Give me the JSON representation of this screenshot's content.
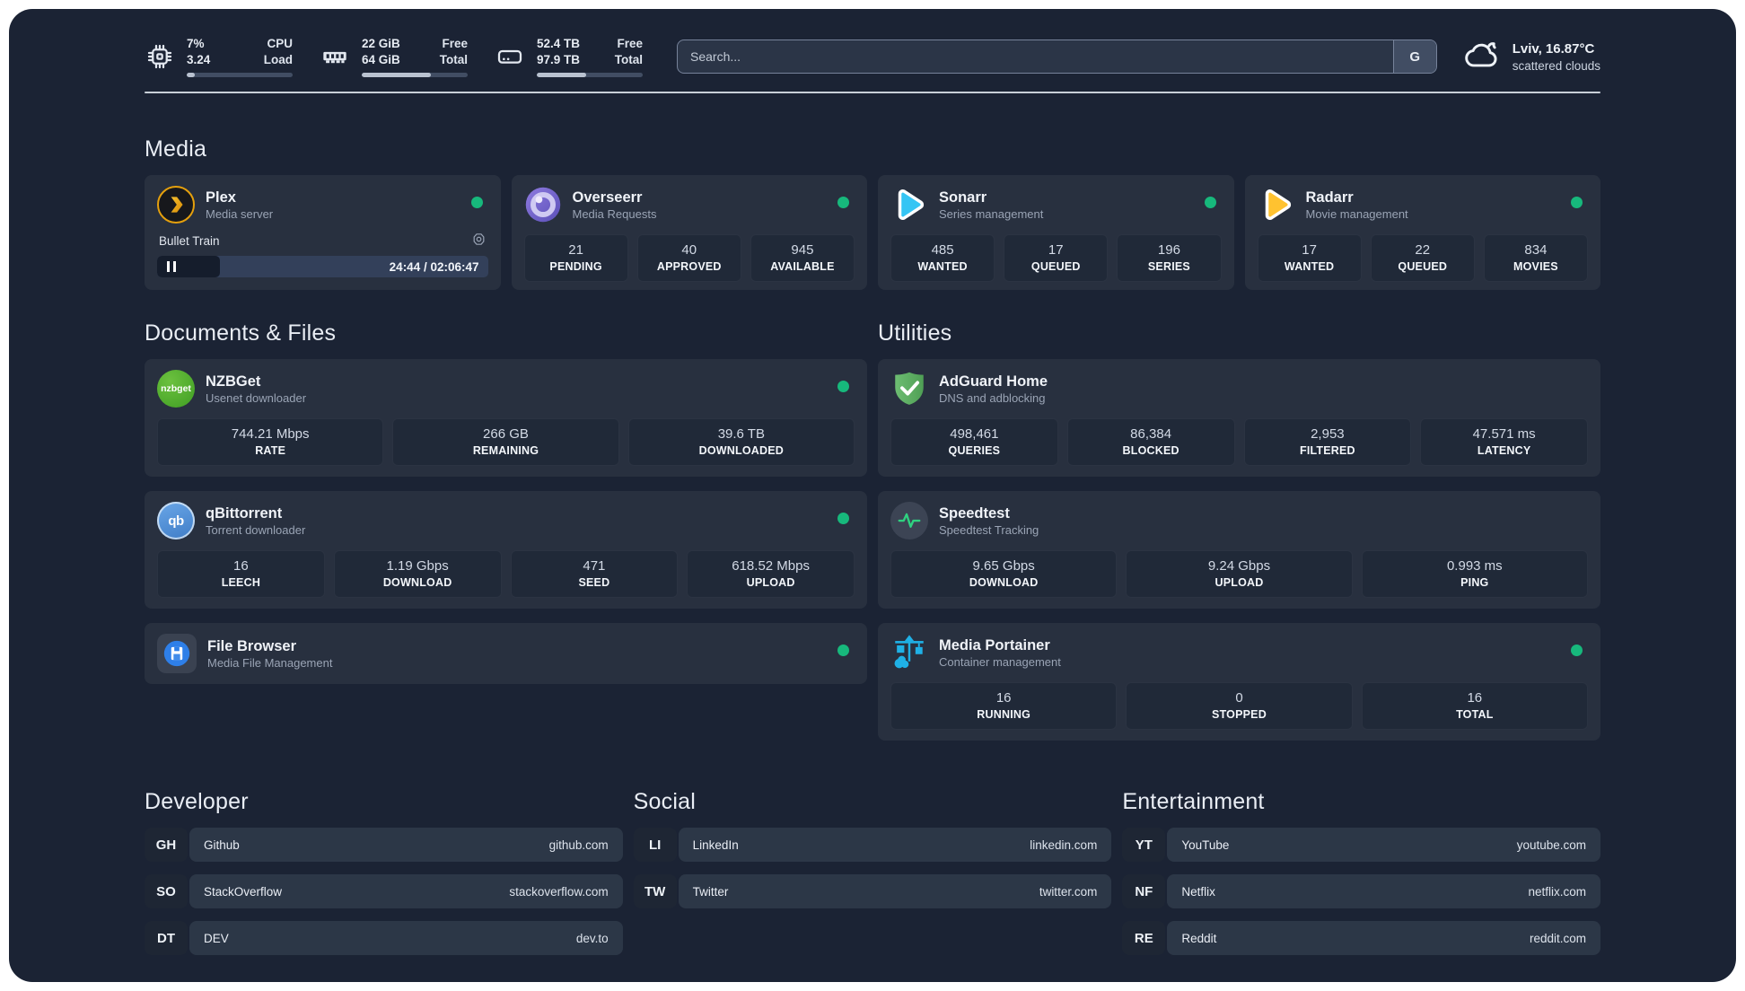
{
  "topbar": {
    "metrics": [
      {
        "values": [
          "7%",
          "3.24"
        ],
        "labels": [
          "CPU",
          "Load"
        ],
        "progress": 8
      },
      {
        "values": [
          "22 GiB",
          "64 GiB"
        ],
        "labels": [
          "Free",
          "Total"
        ],
        "progress": 65
      },
      {
        "values": [
          "52.4 TB",
          "97.9 TB"
        ],
        "labels": [
          "Free",
          "Total"
        ],
        "progress": 47
      }
    ],
    "search": {
      "placeholder": "Search...",
      "button_label": "G"
    },
    "weather": {
      "location_temp": "Lviv, 16.87°C",
      "condition": "scattered clouds"
    }
  },
  "sections": {
    "media": {
      "title": "Media",
      "apps": [
        {
          "name": "Plex",
          "desc": "Media server",
          "player": {
            "title": "Bullet Train",
            "time": "24:44 / 02:06:47",
            "progress": 19
          }
        },
        {
          "name": "Overseerr",
          "desc": "Media Requests",
          "stats": [
            {
              "value": "21",
              "label": "PENDING"
            },
            {
              "value": "40",
              "label": "APPROVED"
            },
            {
              "value": "945",
              "label": "AVAILABLE"
            }
          ]
        },
        {
          "name": "Sonarr",
          "desc": "Series management",
          "stats": [
            {
              "value": "485",
              "label": "WANTED"
            },
            {
              "value": "17",
              "label": "QUEUED"
            },
            {
              "value": "196",
              "label": "SERIES"
            }
          ]
        },
        {
          "name": "Radarr",
          "desc": "Movie management",
          "stats": [
            {
              "value": "17",
              "label": "WANTED"
            },
            {
              "value": "22",
              "label": "QUEUED"
            },
            {
              "value": "834",
              "label": "MOVIES"
            }
          ]
        }
      ]
    },
    "documents": {
      "title": "Documents & Files",
      "apps": [
        {
          "name": "NZBGet",
          "desc": "Usenet downloader",
          "icon_text": "nzbget",
          "stats": [
            {
              "value": "744.21 Mbps",
              "label": "RATE"
            },
            {
              "value": "266 GB",
              "label": "REMAINING"
            },
            {
              "value": "39.6 TB",
              "label": "DOWNLOADED"
            }
          ]
        },
        {
          "name": "qBittorrent",
          "desc": "Torrent downloader",
          "icon_text": "qb",
          "stats": [
            {
              "value": "16",
              "label": "LEECH"
            },
            {
              "value": "1.19 Gbps",
              "label": "DOWNLOAD"
            },
            {
              "value": "471",
              "label": "SEED"
            },
            {
              "value": "618.52 Mbps",
              "label": "UPLOAD"
            }
          ]
        },
        {
          "name": "File Browser",
          "desc": "Media File Management"
        }
      ]
    },
    "utilities": {
      "title": "Utilities",
      "apps": [
        {
          "name": "AdGuard Home",
          "desc": "DNS and adblocking",
          "stats": [
            {
              "value": "498,461",
              "label": "QUERIES"
            },
            {
              "value": "86,384",
              "label": "BLOCKED"
            },
            {
              "value": "2,953",
              "label": "FILTERED"
            },
            {
              "value": "47.571 ms",
              "label": "LATENCY"
            }
          ]
        },
        {
          "name": "Speedtest",
          "desc": "Speedtest Tracking",
          "stats": [
            {
              "value": "9.65 Gbps",
              "label": "DOWNLOAD"
            },
            {
              "value": "9.24 Gbps",
              "label": "UPLOAD"
            },
            {
              "value": "0.993 ms",
              "label": "PING"
            }
          ]
        },
        {
          "name": "Media Portainer",
          "desc": "Container management",
          "stats": [
            {
              "value": "16",
              "label": "RUNNING"
            },
            {
              "value": "0",
              "label": "STOPPED"
            },
            {
              "value": "16",
              "label": "TOTAL"
            }
          ]
        }
      ]
    },
    "links": [
      {
        "title": "Developer",
        "items": [
          {
            "badge": "GH",
            "name": "Github",
            "url": "github.com"
          },
          {
            "badge": "SO",
            "name": "StackOverflow",
            "url": "stackoverflow.com"
          },
          {
            "badge": "DT",
            "name": "DEV",
            "url": "dev.to"
          }
        ]
      },
      {
        "title": "Social",
        "items": [
          {
            "badge": "LI",
            "name": "LinkedIn",
            "url": "linkedin.com"
          },
          {
            "badge": "TW",
            "name": "Twitter",
            "url": "twitter.com"
          }
        ]
      },
      {
        "title": "Entertainment",
        "items": [
          {
            "badge": "YT",
            "name": "YouTube",
            "url": "youtube.com"
          },
          {
            "badge": "NF",
            "name": "Netflix",
            "url": "netflix.com"
          },
          {
            "badge": "RE",
            "name": "Reddit",
            "url": "reddit.com"
          }
        ]
      }
    ]
  },
  "colors": {
    "status_online": "#17b87c",
    "plex_amber": "#e5a00d",
    "sonarr_blue": "#35c5f4",
    "radarr_yellow": "#ffc230",
    "portainer_blue": "#1fb1e6",
    "adguard_green": "#63b663"
  }
}
